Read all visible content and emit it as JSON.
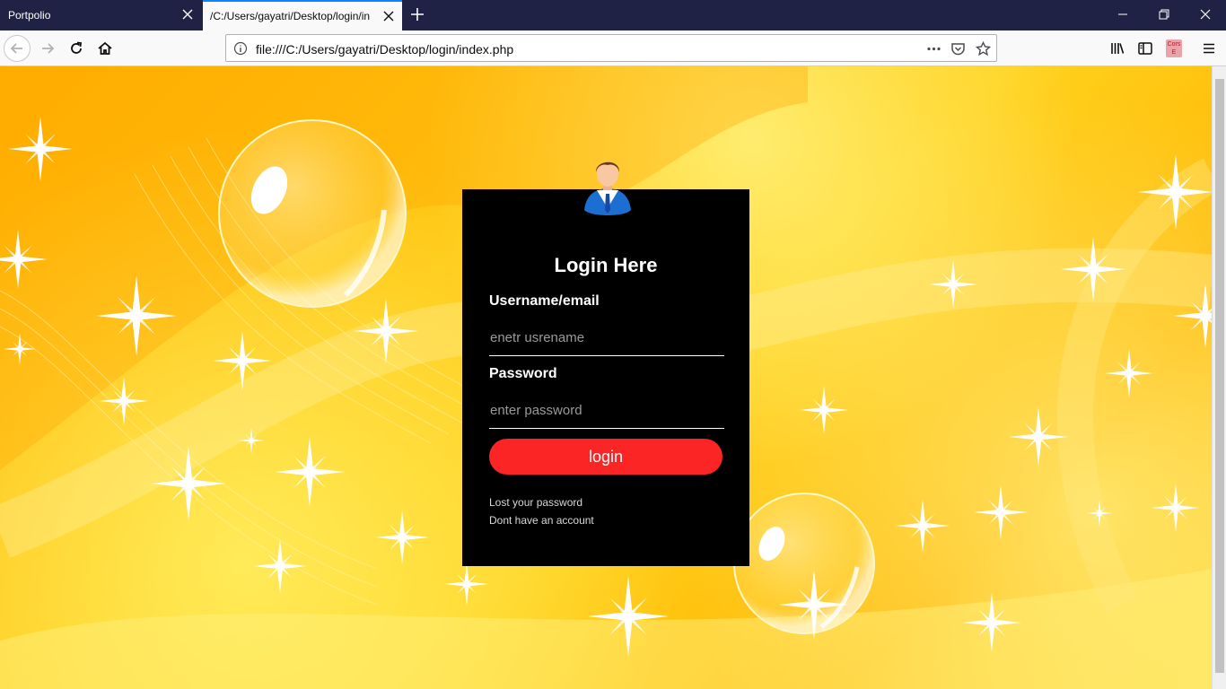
{
  "browser": {
    "tabs": [
      {
        "title": "Portpolio",
        "active": false
      },
      {
        "title": "/C:/Users/gayatri/Desktop/login/in",
        "active": true
      }
    ],
    "url": "file:///C:/Users/gayatri/Desktop/login/index.php",
    "extension_label_top": "Cors",
    "extension_label_bottom": "E",
    "colors": {
      "tabstrip": "#1f2244",
      "active_tab_accent": "#0a84ff",
      "toolbar": "#f9f9fa"
    }
  },
  "login": {
    "title": "Login Here",
    "username_label": "Username/email",
    "username_placeholder": "enetr usrename",
    "password_label": "Password",
    "password_placeholder": "enter password",
    "submit_label": "login",
    "lost_password_link": "Lost your password",
    "no_account_link": "Dont have an account",
    "colors": {
      "card": "#000000",
      "button": "#fb2525",
      "text": "#ffffff"
    }
  },
  "background": {
    "theme": "yellow sparkles and bubbles",
    "colors": [
      "#ffb000",
      "#ffd21e",
      "#ffffff"
    ]
  }
}
